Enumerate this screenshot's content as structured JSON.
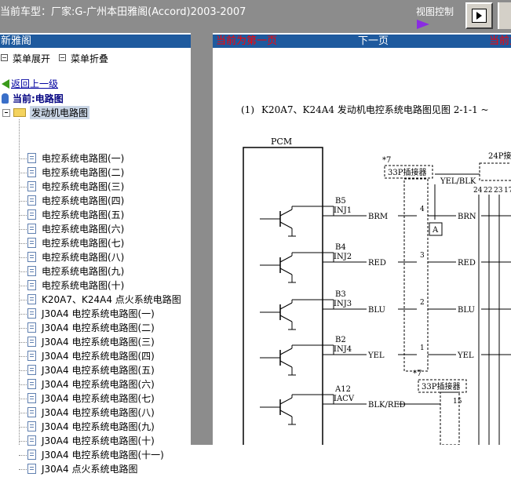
{
  "header": {
    "car_model": "当前车型：厂家:G-广州本田雅阁(Accord)2003-2007",
    "view_control": "视图控制"
  },
  "left_panel": {
    "title": "新雅阁",
    "expand_label": "菜单展开",
    "collapse_label": "菜单折叠",
    "back_label": "返回上一级",
    "current_label": "当前:电路图",
    "tree_root": "发动机电路图",
    "items": [
      "电控系统电路图(一)",
      "电控系统电路图(二)",
      "电控系统电路图(三)",
      "电控系统电路图(四)",
      "电控系统电路图(五)",
      "电控系统电路图(六)",
      "电控系统电路图(七)",
      "电控系统电路图(八)",
      "电控系统电路图(九)",
      "电控系统电路图(十)",
      "K20A7、K24A4 点火系统电路图",
      "J30A4 电控系统电路图(一)",
      "J30A4 电控系统电路图(二)",
      "J30A4 电控系统电路图(三)",
      "J30A4 电控系统电路图(四)",
      "J30A4 电控系统电路图(五)",
      "J30A4 电控系统电路图(六)",
      "J30A4 电控系统电路图(七)",
      "J30A4 电控系统电路图(八)",
      "J30A4 电控系统电路图(九)",
      "J30A4 电控系统电路图(十)",
      "J30A4 电控系统电路图(十一)",
      "J30A4 点火系统电路图"
    ]
  },
  "right_panel": {
    "first_page": "当前为第一页",
    "next_page": "下一页",
    "current_cut": "当前为"
  },
  "diagram": {
    "caption_num": "(1)",
    "caption": "K20A7、K24A4 发动机电控系统电路图见图 2-1-1 ~",
    "pcm": "PCM",
    "conn33_top": "33P插接器",
    "conn33_bottom": "33P插接器",
    "conn24": "24P接",
    "star7_a": "*7",
    "star7_b": "*7",
    "pins24": [
      "24",
      "22",
      "23",
      "17"
    ],
    "yel_blk": "YEL/BLK",
    "box_a": "A",
    "pin_num_15": "15",
    "rows": [
      {
        "pin": "B5",
        "name": "INJ1",
        "wire": "BRM",
        "num": "4",
        "out": "BRN"
      },
      {
        "pin": "B4",
        "name": "INJ2",
        "wire": "RED",
        "num": "3",
        "out": "RED"
      },
      {
        "pin": "B3",
        "name": "INJ3",
        "wire": "BLU",
        "num": "2",
        "out": "BLU"
      },
      {
        "pin": "B2",
        "name": "INJ4",
        "wire": "YEL",
        "num": "1",
        "out": "YEL"
      },
      {
        "pin": "A12",
        "name": "IACV",
        "wire": "BLK/RED",
        "num": "",
        "out": ""
      }
    ]
  }
}
